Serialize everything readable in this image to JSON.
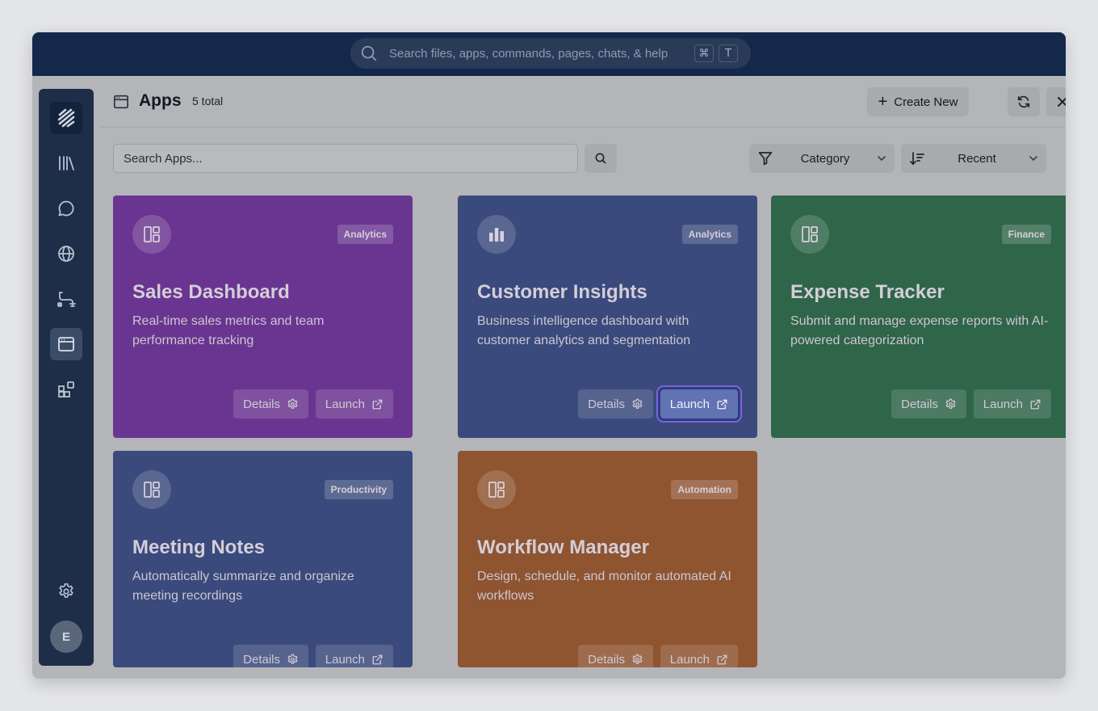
{
  "global_search": {
    "placeholder": "Search files, apps, commands, pages, chats, & help",
    "shortcut_keys": [
      "⌘",
      "T"
    ]
  },
  "sidebar": {
    "items": [
      {
        "icon": "logo-icon"
      },
      {
        "icon": "library-icon"
      },
      {
        "icon": "chat-icon"
      },
      {
        "icon": "globe-icon"
      },
      {
        "icon": "workflow-icon"
      },
      {
        "icon": "apps-icon",
        "active": true
      },
      {
        "icon": "integrations-icon"
      }
    ],
    "settings_icon": "gear-icon",
    "avatar_initial": "E"
  },
  "header": {
    "title": "Apps",
    "count": "5 total",
    "create_label": "Create New"
  },
  "toolbar": {
    "search_placeholder": "Search Apps...",
    "category_label": "Category",
    "sort_label": "Recent"
  },
  "cards": [
    {
      "title": "Sales Dashboard",
      "badge": "Analytics",
      "description": "Real-time sales metrics and team performance tracking",
      "details_label": "Details",
      "launch_label": "Launch",
      "color": "#6a3590",
      "icon": "layout-icon"
    },
    {
      "title": "Customer Insights",
      "badge": "Analytics",
      "description": "Business intelligence dashboard with customer analytics and segmentation",
      "details_label": "Details",
      "launch_label": "Launch",
      "color": "#3a4a7c",
      "icon": "bar-chart-icon",
      "launch_highlighted": true
    },
    {
      "title": "Expense Tracker",
      "badge": "Finance",
      "description": "Submit and manage expense reports with AI-powered categorization",
      "details_label": "Details",
      "launch_label": "Launch",
      "color": "#2f6549",
      "icon": "layout-icon"
    },
    {
      "title": "Meeting Notes",
      "badge": "Productivity",
      "description": "Automatically summarize and organize meeting recordings",
      "details_label": "Details",
      "launch_label": "Launch",
      "color": "#3a4a7c",
      "icon": "layout-icon"
    },
    {
      "title": "Workflow Manager",
      "badge": "Automation",
      "description": "Design, schedule, and monitor automated AI workflows",
      "details_label": "Details",
      "launch_label": "Launch",
      "color": "#8f5430",
      "icon": "layout-icon"
    }
  ]
}
